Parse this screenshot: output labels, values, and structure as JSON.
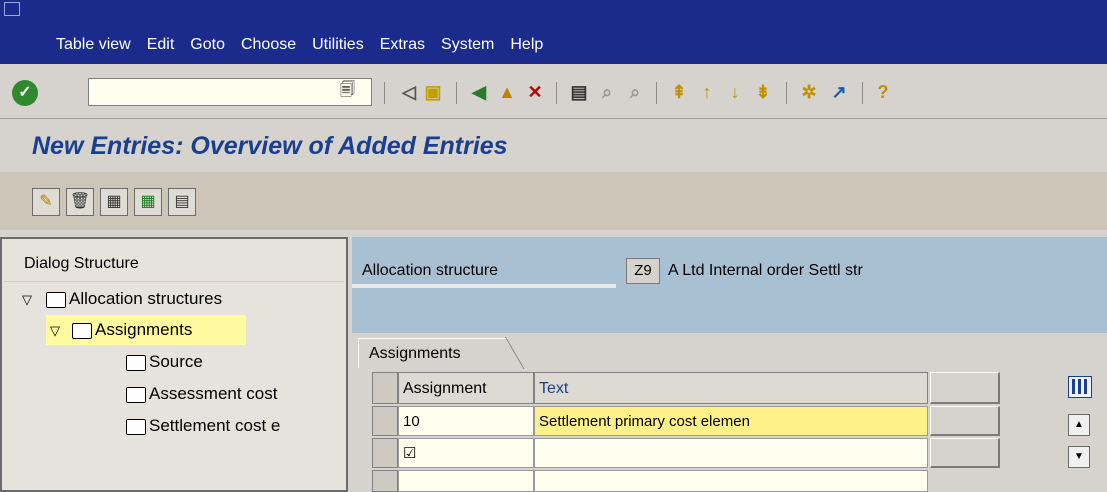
{
  "menu": {
    "items": [
      {
        "label": "Table view"
      },
      {
        "label": "Edit"
      },
      {
        "label": "Goto"
      },
      {
        "label": "Choose"
      },
      {
        "label": "Utilities"
      },
      {
        "label": "Extras"
      },
      {
        "label": "System"
      },
      {
        "label": "Help"
      }
    ]
  },
  "page": {
    "title": "New Entries: Overview of Added Entries"
  },
  "dialog": {
    "title": "Dialog Structure",
    "tree": [
      {
        "label": "Allocation structures",
        "level": 0,
        "expanded": true
      },
      {
        "label": "Assignments",
        "level": 1,
        "expanded": true,
        "selected": true
      },
      {
        "label": "Source",
        "level": 2
      },
      {
        "label": "Assessment cost",
        "level": 2
      },
      {
        "label": "Settlement cost e",
        "level": 2
      }
    ]
  },
  "allocation": {
    "label": "Allocation structure",
    "code": "Z9",
    "description": "A Ltd Internal order Settl str"
  },
  "table": {
    "tab_label": "Assignments",
    "columns": [
      "Assignment",
      "Text"
    ],
    "rows": [
      {
        "assignment": "10",
        "text": "Settlement primary cost elemen"
      },
      {
        "assignment": "☑",
        "text": ""
      }
    ]
  },
  "colors": {
    "menubar": "#1a2b8c",
    "title": "#1a3f8f",
    "selected_highlight": "#fffaa0",
    "header_panel": "#a9c0d3"
  }
}
